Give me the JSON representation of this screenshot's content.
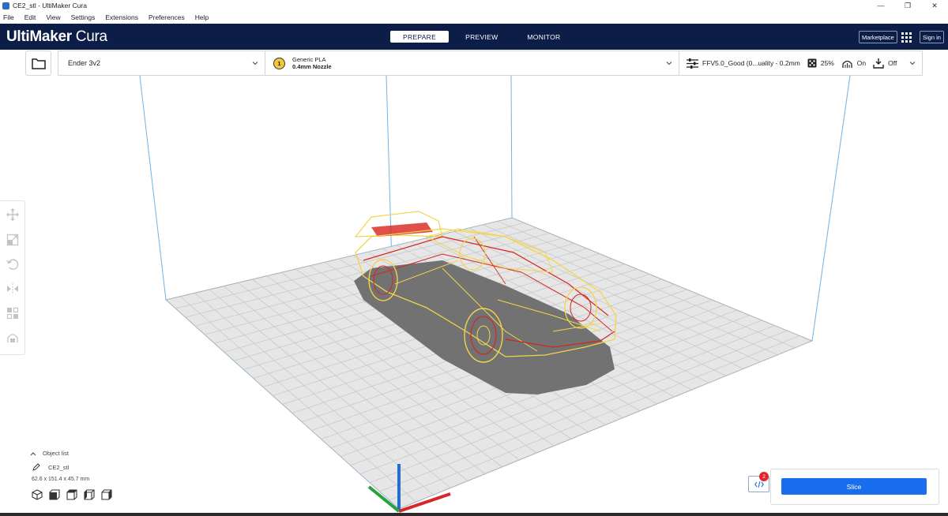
{
  "window": {
    "title": "CE2_stl - UltiMaker Cura",
    "minimize_glyph": "—",
    "restore_glyph": "❐",
    "close_glyph": "✕"
  },
  "menu": [
    "File",
    "Edit",
    "View",
    "Settings",
    "Extensions",
    "Preferences",
    "Help"
  ],
  "header": {
    "logo_bold": "UltiMaker",
    "logo_light": " Cura",
    "stages": [
      "PREPARE",
      "PREVIEW",
      "MONITOR"
    ],
    "active_stage": "PREPARE",
    "marketplace_label": "Marketplace",
    "signin_label": "Sign in"
  },
  "toolbar": {
    "printer": "Ender 3v2",
    "extruder_number": "1",
    "material": "Generic PLA",
    "nozzle": "0.4mm Nozzle",
    "profile": "FFV5.0_Good (0...uality - 0.2mm",
    "infill": "25%",
    "support": "On",
    "adhesion": "Off"
  },
  "left_tools": [
    "move-tool",
    "scale-tool",
    "rotate-tool",
    "mirror-tool",
    "per-model-settings-tool",
    "support-blocker-tool"
  ],
  "object_list": {
    "header": "Object list",
    "object_name": "CE2_stl",
    "dimensions": "62.6 x 151.4 x 45.7 mm"
  },
  "messages": {
    "count": "2"
  },
  "slice": {
    "label": "Slice"
  },
  "colors": {
    "header_bg": "#0c1d47",
    "slice_blue": "#196ef0",
    "build_volume_line": "#5aa9e6",
    "model_yellow": "#f2d44c",
    "model_red": "#d8231c"
  }
}
